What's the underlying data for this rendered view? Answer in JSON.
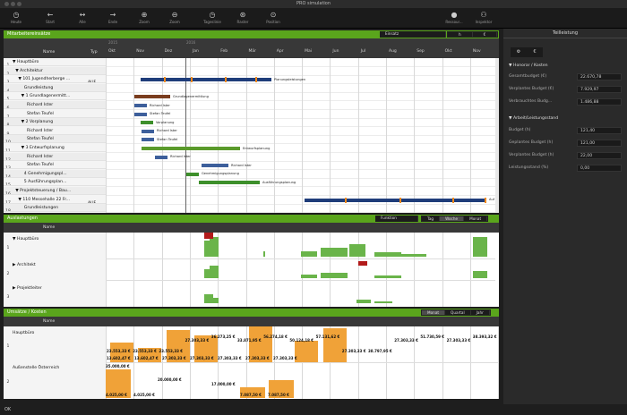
{
  "window": {
    "title": "PRO simulation"
  },
  "toolbar": [
    {
      "label": "Heute",
      "icon": "clock-icon"
    },
    {
      "label": "Start",
      "icon": "back-arrow-icon"
    },
    {
      "label": "Alle",
      "icon": "expand-icon"
    },
    {
      "label": "Ende",
      "icon": "forward-arrow-icon"
    },
    {
      "label": "Zoom",
      "icon": "zoom-in-icon"
    },
    {
      "label": "Zoom",
      "icon": "zoom-out-icon"
    },
    {
      "label": "Tageslinie",
      "icon": "clock-icon"
    },
    {
      "label": "Raster",
      "icon": "grid-icon"
    },
    {
      "label": "Position",
      "icon": "target-icon"
    },
    {
      "label": "Ressour...",
      "icon": "person-icon"
    },
    {
      "label": "Inspektor",
      "icon": "binoculars-icon"
    }
  ],
  "panel1": {
    "title": "Mitarbeitereinsätze",
    "selector": "Einsatz",
    "unit_h": "h",
    "unit_eur": "€",
    "col_name": "Name",
    "col_typ": "Typ",
    "year1": "2015",
    "year2": "2016",
    "months": [
      "Okt",
      "Nov",
      "Dez",
      "Jan",
      "Feb",
      "Mär",
      "Apr",
      "Mai",
      "Jun",
      "Jul",
      "Aug",
      "Sep",
      "Okt",
      "Nov"
    ],
    "rows": [
      {
        "n": "1",
        "name": "▼ Hauptbüro",
        "typ": ""
      },
      {
        "n": "2",
        "name": "  ▼ Architektur",
        "typ": ""
      },
      {
        "n": "3",
        "name": "    ▼ 101 Jugendherberge ...",
        "typ": "AUF"
      },
      {
        "n": "4",
        "name": "        Grundleistung",
        "typ": ""
      },
      {
        "n": "5",
        "name": "      ▼ 1 Grundlagenermitt...",
        "typ": ""
      },
      {
        "n": "6",
        "name": "          Richard Ister",
        "typ": ""
      },
      {
        "n": "7",
        "name": "          Stefan Teufel",
        "typ": ""
      },
      {
        "n": "8",
        "name": "      ▼ 2 Vorplanung",
        "typ": ""
      },
      {
        "n": "9",
        "name": "          Richard Ister",
        "typ": ""
      },
      {
        "n": "10",
        "name": "          Stefan Teufel",
        "typ": ""
      },
      {
        "n": "11",
        "name": "      ▼ 3 Entwurfsplanung",
        "typ": ""
      },
      {
        "n": "12",
        "name": "          Richard Ister",
        "typ": ""
      },
      {
        "n": "13",
        "name": "          Stefan Teufel",
        "typ": ""
      },
      {
        "n": "14",
        "name": "        4 Genehmigungspl...",
        "typ": ""
      },
      {
        "n": "15",
        "name": "        5 Ausführungsplan...",
        "typ": ""
      },
      {
        "n": "16",
        "name": "  ▼ Projektsteuerung / Bau...",
        "typ": ""
      },
      {
        "n": "17",
        "name": "    ▼ 110 Messehalle 22 Fr...",
        "typ": "AUF"
      },
      {
        "n": "18",
        "name": "        Grundleistungen",
        "typ": ""
      }
    ],
    "bar_labels": [
      "Planungsleistungen",
      "Grundlagenermittlung",
      "Richard Ister",
      "Stefan Teufel",
      "Vorplanung",
      "Richard Ister",
      "Stefan Teufel",
      "Entwurfsplanung",
      "Richard Ister",
      "Richard Ister",
      "Genehmigungsplanung",
      "Ausführungsplanung",
      "Auf"
    ]
  },
  "panel2": {
    "title": "Auslastungen",
    "selector": "Funktion",
    "tabs": [
      "Tag",
      "Woche",
      "Monat"
    ],
    "col_name": "Name",
    "rows": [
      {
        "n": "1",
        "name": "▼ Hauptbüro"
      },
      {
        "n": "2",
        "name": "▶ Architekt"
      },
      {
        "n": "3",
        "name": "▶ Projektleiter"
      }
    ]
  },
  "panel3": {
    "title": "Umsätze / Kosten",
    "tabs": [
      "Monat",
      "Quartal",
      "Jahr"
    ],
    "col_name": "Name",
    "rows": [
      {
        "n": "1",
        "name": "Hauptbüro"
      },
      {
        "n": "2",
        "name": "Außenstelle Österreich"
      }
    ],
    "row1_values": [
      "23.553,33 €",
      "23.553,33 €",
      "23.553,33 €",
      "27.303,33 €",
      "36.273,25 €",
      "33.871,95 €",
      "56.274,18 €",
      "50.124,18 €",
      "57.131,62 €",
      "27.303,33 €",
      "38.797,95 €",
      "27.303,33 €",
      "51.730,59 €",
      "27.303,33 €",
      "38.393,32 €"
    ],
    "row1_values_b": [
      "13.602,47 €",
      "13.602,47 €",
      "27.303,33 €",
      "27.303,33 €",
      "27.303,33 €",
      "27.303,33 €",
      "27.303,33 €"
    ],
    "row2_values": [
      "35.000,00 €",
      "4.025,00 €",
      "4.025,00 €",
      "20.000,00 €",
      "17.000,00 €",
      "7.087,50 €"
    ]
  },
  "inspector": {
    "title": "Teilleistung",
    "section1": "▼ Honorar / Kosten",
    "fields1": [
      {
        "k": "Gesamtbudget (€)",
        "v": "22.670,78"
      },
      {
        "k": "Verplantes Budget (€)",
        "v": "7.929,97"
      },
      {
        "k": "Verbrauchtes Budg...",
        "v": "1.486,88"
      }
    ],
    "section2": "▼ Arbeit/Leistungsstand",
    "fields2": [
      {
        "k": "Budget (h)",
        "v": "121,40"
      },
      {
        "k": "Geplantes Budget (h)",
        "v": "121,00"
      },
      {
        "k": "Verplantes Budget (h)",
        "v": "22,00"
      },
      {
        "k": "Leistungsstand (%)",
        "v": "0,00"
      }
    ]
  },
  "footer": {
    "ok": "OK"
  }
}
